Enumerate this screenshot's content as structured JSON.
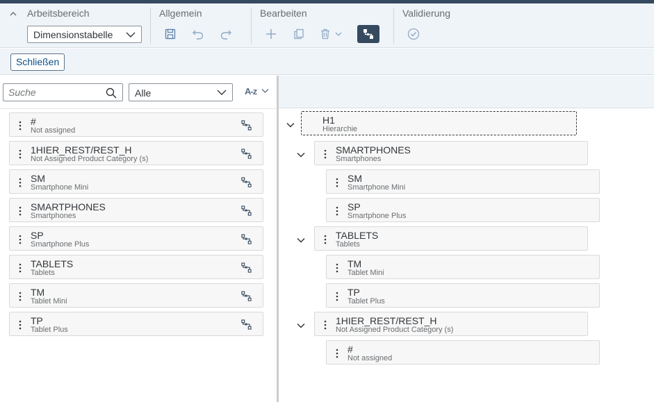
{
  "ribbon": {
    "workspace": {
      "title": "Arbeitsbereich",
      "selected": "Dimensionstabelle"
    },
    "general": {
      "title": "Allgemein"
    },
    "edit": {
      "title": "Bearbeiten"
    },
    "validation": {
      "title": "Validierung"
    }
  },
  "close_label": "Schließen",
  "left": {
    "search_placeholder": "Suche",
    "filter_value": "Alle",
    "sort_label": "A-z",
    "members": [
      {
        "id": "#",
        "desc": "Not assigned"
      },
      {
        "id": "1HIER_REST/REST_H",
        "desc": "Not Assigned Product Category (s)"
      },
      {
        "id": "SM",
        "desc": "Smartphone Mini"
      },
      {
        "id": "SMARTPHONES",
        "desc": "Smartphones"
      },
      {
        "id": "SP",
        "desc": "Smartphone Plus"
      },
      {
        "id": "TABLETS",
        "desc": "Tablets"
      },
      {
        "id": "TM",
        "desc": "Tablet Mini"
      },
      {
        "id": "TP",
        "desc": "Tablet Plus"
      }
    ]
  },
  "tree": {
    "root": {
      "id": "H1",
      "desc": "Hierarchie"
    },
    "nodes": [
      {
        "id": "SMARTPHONES",
        "desc": "Smartphones"
      },
      {
        "id": "SM",
        "desc": "Smartphone Mini"
      },
      {
        "id": "SP",
        "desc": "Smartphone Plus"
      },
      {
        "id": "TABLETS",
        "desc": "Tablets"
      },
      {
        "id": "TM",
        "desc": "Tablet Mini"
      },
      {
        "id": "TP",
        "desc": "Tablet Plus"
      },
      {
        "id": "1HIER_REST/REST_H",
        "desc": "Not Assigned Product Category (s)"
      },
      {
        "id": "#",
        "desc": "Not assigned"
      }
    ]
  },
  "colors": {
    "accent": "#0a6ed1",
    "toolbar_bg": "#eff4f9",
    "active_button": "#354a5f",
    "icon": "#5a7fa8"
  }
}
